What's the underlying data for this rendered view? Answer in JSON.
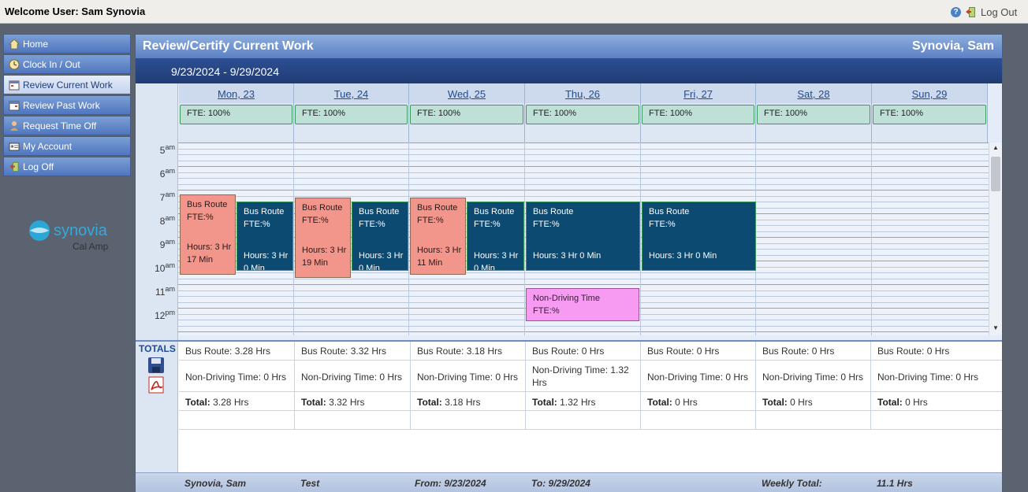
{
  "topbar": {
    "welcome": "Welcome User: Sam Synovia",
    "logout_label": "Log Out"
  },
  "sidebar": {
    "items": [
      {
        "label": "Home",
        "icon": "home-icon"
      },
      {
        "label": "Clock In / Out",
        "icon": "clock-icon"
      },
      {
        "label": "Review Current Work",
        "icon": "calendar-icon",
        "active": true
      },
      {
        "label": "Review Past Work",
        "icon": "calendar-icon"
      },
      {
        "label": "Request Time Off",
        "icon": "user-icon"
      },
      {
        "label": "My Account",
        "icon": "id-card-icon"
      },
      {
        "label": "Log Off",
        "icon": "door-icon"
      }
    ],
    "logo": {
      "brand": "synovia",
      "sub": "Cal Amp"
    }
  },
  "main": {
    "title": "Review/Certify Current Work",
    "user": "Synovia, Sam",
    "date_range": "9/23/2024 - 9/29/2024"
  },
  "days": [
    {
      "label": "Mon, 23",
      "fte": "FTE: 100%"
    },
    {
      "label": "Tue, 24",
      "fte": "FTE: 100%"
    },
    {
      "label": "Wed, 25",
      "fte": "FTE: 100%"
    },
    {
      "label": "Thu, 26",
      "fte": "FTE: 100%"
    },
    {
      "label": "Fri, 27",
      "fte": "FTE: 100%"
    },
    {
      "label": "Sat, 28",
      "fte": "FTE: 100%"
    },
    {
      "label": "Sun, 29",
      "fte": "FTE: 100%"
    }
  ],
  "time_labels": [
    {
      "h": "5",
      "ap": "am"
    },
    {
      "h": "6",
      "ap": "am"
    },
    {
      "h": "7",
      "ap": "am"
    },
    {
      "h": "8",
      "ap": "am"
    },
    {
      "h": "9",
      "ap": "am"
    },
    {
      "h": "10",
      "ap": "am"
    },
    {
      "h": "11",
      "ap": "am"
    },
    {
      "h": "12",
      "ap": "pm"
    }
  ],
  "events": [
    {
      "title": "Bus Route",
      "fte": "FTE:%",
      "hours": "Hours: 3 Hr 17 Min"
    },
    {
      "title": "Bus Route",
      "fte": "FTE:%",
      "hours": "Hours: 3 Hr 0 Min"
    },
    {
      "title": "Bus Route",
      "fte": "FTE:%",
      "hours": "Hours: 3 Hr 19 Min"
    },
    {
      "title": "Bus Route",
      "fte": "FTE:%",
      "hours": "Hours: 3 Hr 0 Min"
    },
    {
      "title": "Bus Route",
      "fte": "FTE:%",
      "hours": "Hours: 3 Hr 11 Min"
    },
    {
      "title": "Bus Route",
      "fte": "FTE:%",
      "hours": "Hours: 3 Hr 0 Min"
    },
    {
      "title": "Bus Route",
      "fte": "FTE:%",
      "hours": "Hours: 3 Hr 0 Min"
    },
    {
      "title": "Non-Driving Time",
      "fte": "FTE:%",
      "hours": ""
    },
    {
      "title": "Bus Route",
      "fte": "FTE:%",
      "hours": "Hours: 3 Hr 0 Min"
    }
  ],
  "totals": {
    "label": "TOTALS",
    "total_prefix": "Total:",
    "days": [
      {
        "bus": "Bus Route: 3.28 Hrs",
        "nondriving": "Non-Driving Time: 0 Hrs",
        "total": "3.28 Hrs"
      },
      {
        "bus": "Bus Route: 3.32 Hrs",
        "nondriving": "Non-Driving Time: 0 Hrs",
        "total": "3.32 Hrs"
      },
      {
        "bus": "Bus Route: 3.18 Hrs",
        "nondriving": "Non-Driving Time: 0 Hrs",
        "total": "3.18 Hrs"
      },
      {
        "bus": "Bus Route: 0 Hrs",
        "nondriving": "Non-Driving Time: 1.32 Hrs",
        "total": "1.32 Hrs"
      },
      {
        "bus": "Bus Route: 0 Hrs",
        "nondriving": "Non-Driving Time: 0 Hrs",
        "total": "0 Hrs"
      },
      {
        "bus": "Bus Route: 0 Hrs",
        "nondriving": "Non-Driving Time: 0 Hrs",
        "total": "0 Hrs"
      },
      {
        "bus": "Bus Route: 0 Hrs",
        "nondriving": "Non-Driving Time: 0 Hrs",
        "total": "0 Hrs"
      }
    ]
  },
  "footer": {
    "name": "Synovia, Sam",
    "status": "Test",
    "from": "From: 9/23/2024",
    "to": "To: 9/29/2024",
    "weekly_label": "Weekly Total:",
    "weekly_value": "11.1 Hrs"
  },
  "colors": {
    "bus_route_long": "#f2958b",
    "bus_route": "#0d4a72",
    "non_driving": "#f79af2",
    "fte_box": "#bfe0d6"
  }
}
